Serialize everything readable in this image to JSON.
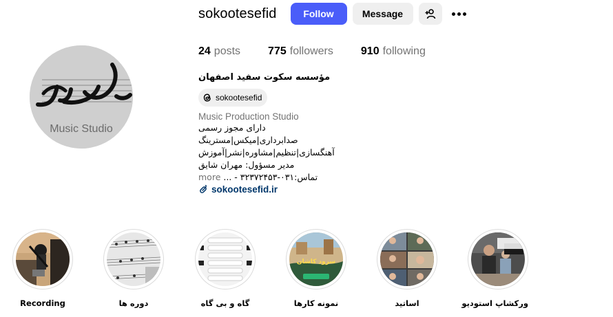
{
  "profile": {
    "username": "sokootesefid",
    "follow_label": "Follow",
    "message_label": "Message",
    "avatar_logo_text": "Music Studio",
    "avatar_logo_script": "سکوت سفید",
    "colors": {
      "follow_bg": "#4a5df9",
      "secondary_bg": "#efefef",
      "link": "#00376b",
      "muted": "#737373"
    }
  },
  "stats": {
    "posts_count": "24",
    "posts_label": "posts",
    "followers_count": "775",
    "followers_label": "followers",
    "following_count": "910",
    "following_label": "following"
  },
  "bio": {
    "full_name": "مؤسسه سکوت سفید اصفهان",
    "threads_handle": "sokootesefid",
    "category": "Music Production Studio",
    "lines": [
      "دارای مجوز رسمی",
      "صدابرداری|میکس|مسترینگ",
      "آهنگسازی|تنظیم|مشاوره|نشر|آموزش",
      "مدیر مسؤول: مهران شایق"
    ],
    "last_line": "تماس:۰۳۱-۳۲۳۷۲۴۵۳ - ...",
    "more_label": "more",
    "link": "sokootesefid.ir"
  },
  "highlights": [
    {
      "label": "Recording",
      "icon": "recording-thumbnail"
    },
    {
      "label": "دوره ها",
      "icon": "sheet-music-thumbnail"
    },
    {
      "label": "گاه و بی گاه",
      "icon": "phone-menu-thumbnail"
    },
    {
      "label": "نمونه کارها",
      "icon": "album-cover-thumbnail",
      "thumb_text": "سرود کاشان"
    },
    {
      "label": "اساتید",
      "icon": "teachers-collage-thumbnail"
    },
    {
      "label": "ورکشاپ استودیو",
      "icon": "studio-workshop-thumbnail"
    }
  ]
}
